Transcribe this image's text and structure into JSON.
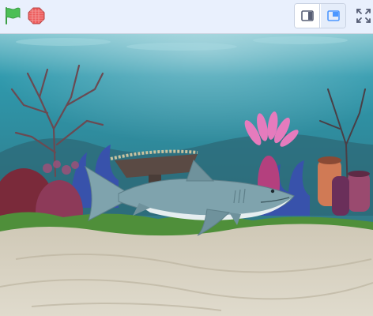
{
  "toolbar": {
    "green_flag": {
      "icon": "green-flag-icon",
      "color": "#4cbf56"
    },
    "stop": {
      "icon": "stop-sign-icon",
      "color": "#ec5959"
    },
    "stage_modes": [
      {
        "icon": "small-stage-icon",
        "selected": false
      },
      {
        "icon": "normal-stage-icon",
        "selected": true
      }
    ],
    "fullscreen": {
      "icon": "fullscreen-icon"
    }
  },
  "stage": {
    "backdrop": "underwater",
    "sprites": [
      {
        "name": "shark",
        "icon": "shark-icon"
      }
    ],
    "colors": {
      "water_top": "#2a8fa8",
      "water_bottom": "#3b7f8c",
      "sand": "#d9d3c3",
      "shark": "#7fa3ad"
    }
  }
}
